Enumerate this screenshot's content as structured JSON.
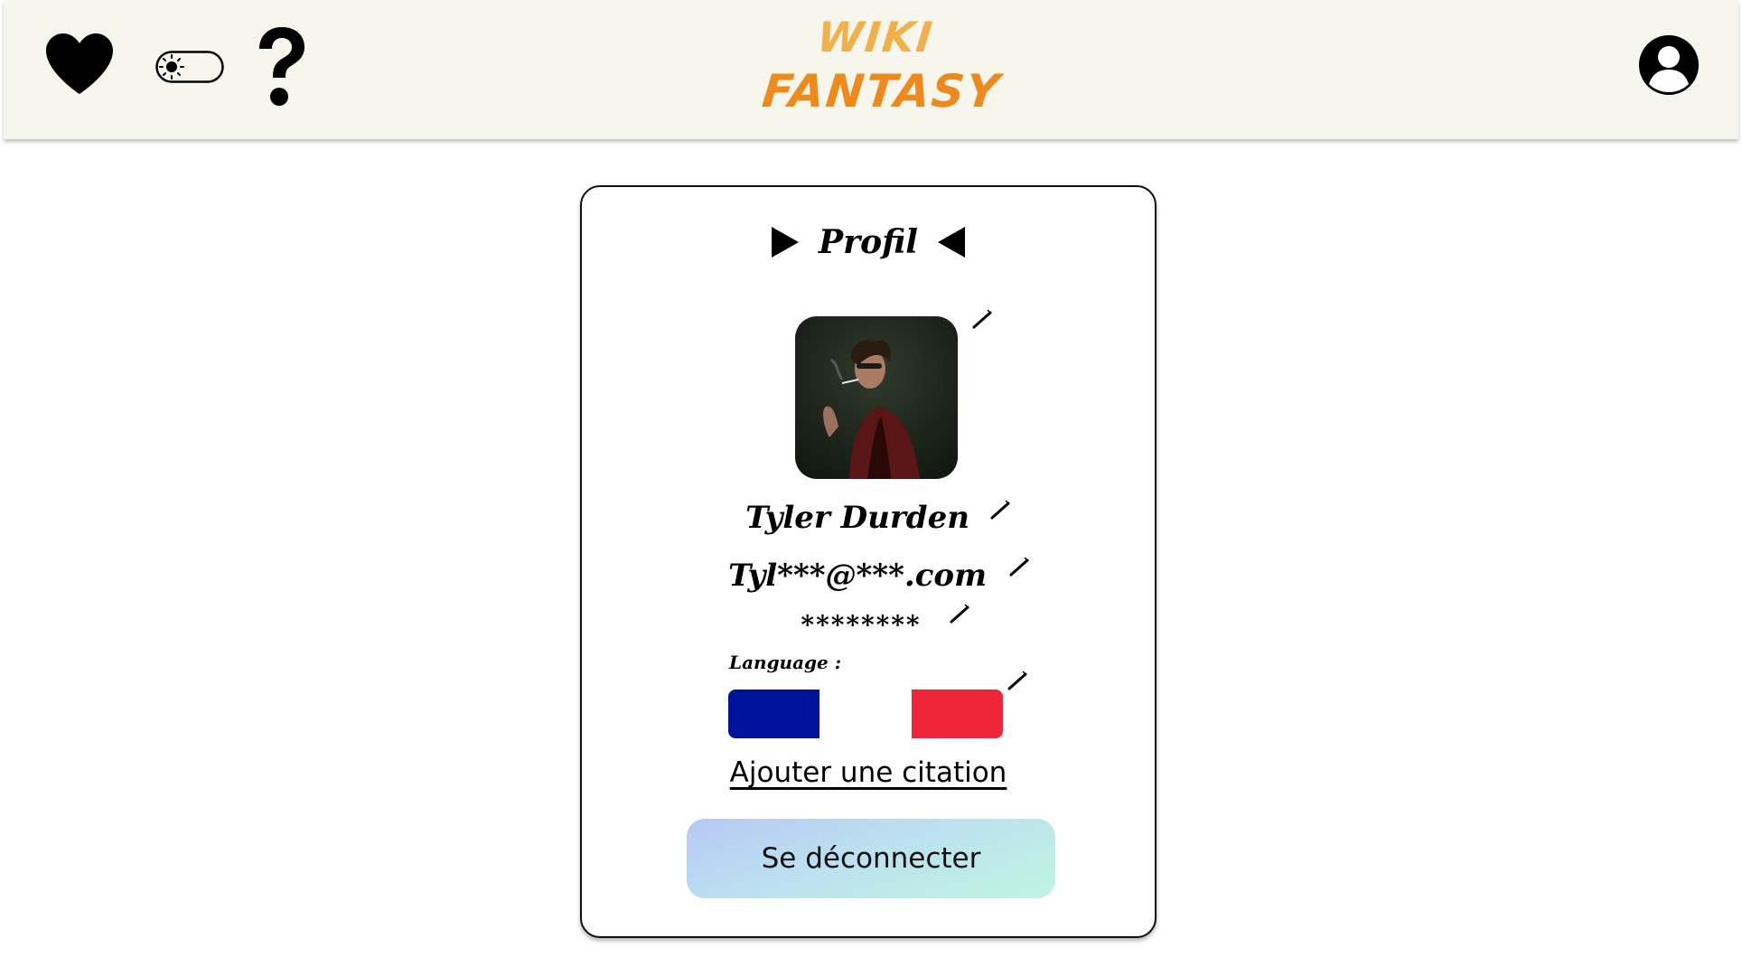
{
  "header": {
    "logo_line1": "WIKI",
    "logo_line2": "FANTASY",
    "icons": {
      "favorites": "heart-icon",
      "theme": "sun-toggle-icon",
      "help": "question-mark-icon",
      "account": "user-circle-icon"
    }
  },
  "profile": {
    "title": "Profil",
    "name": "Tyler Durden",
    "email": "Tyl***@***.com",
    "password": "********",
    "language_label": "Language :",
    "language_flag": "France",
    "add_quote_label": "Ajouter une citation",
    "logout_label": "Se déconnecter"
  },
  "colors": {
    "header_bg": "#f7f6ec",
    "logo_light": "#f0b04b",
    "logo_dark": "#ee8a1b",
    "flag_blue": "#00139c",
    "flag_white": "#ffffff",
    "flag_red": "#ef2538"
  }
}
